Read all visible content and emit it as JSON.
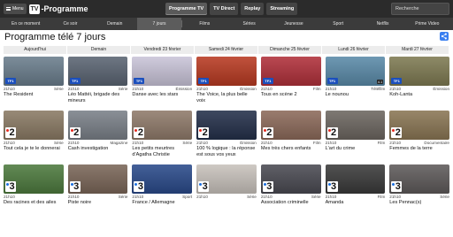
{
  "header": {
    "menu_label": "Menu",
    "logo_box": "TV",
    "logo_text": "-Programme",
    "tabs": [
      {
        "label": "Programme TV"
      },
      {
        "label": "TV Direct"
      },
      {
        "label": "Replay"
      },
      {
        "label": "Streaming"
      }
    ],
    "search_placeholder": "Recherche"
  },
  "subnav": [
    {
      "label": "En ce moment"
    },
    {
      "label": "Ce soir"
    },
    {
      "label": "Demain"
    },
    {
      "label": "7 jours"
    },
    {
      "label": "Films"
    },
    {
      "label": "Séries"
    },
    {
      "label": "Jeunesse"
    },
    {
      "label": "Sport"
    },
    {
      "label": "Netflix"
    },
    {
      "label": "Prime Video"
    }
  ],
  "page_title": "Programme télé 7 jours",
  "days": [
    {
      "label": "Aujourd'hui"
    },
    {
      "label": "Demain"
    },
    {
      "label": "Vendredi 23 février"
    },
    {
      "label": "Samedi 24 février"
    },
    {
      "label": "Dimanche 25 février"
    },
    {
      "label": "Lundi 26 février"
    },
    {
      "label": "Mardi 27 février"
    }
  ],
  "programs": [
    [
      {
        "channel": "TF1",
        "time": "21h10",
        "genre": "Série",
        "title": "The Resident",
        "color": "#6a7d8c"
      },
      {
        "channel": "France 2",
        "time": "21h10",
        "genre": "Série",
        "title": "Tout cela je te le donnerai",
        "color": "#8a7a64"
      },
      {
        "channel": "France 3",
        "time": "21h10",
        "genre": "",
        "title": "Des racines et des ailes",
        "color": "#4d7a3e"
      }
    ],
    [
      {
        "channel": "TF1",
        "time": "21h10",
        "genre": "Série",
        "title": "Léo Mattéi, brigade des mineurs",
        "color": "#5a6472"
      },
      {
        "channel": "France 2",
        "time": "21h10",
        "genre": "Magazine",
        "title": "Cash investigation",
        "color": "#7a8088"
      },
      {
        "channel": "France 3",
        "time": "21h10",
        "genre": "Série",
        "title": "Piste noire",
        "color": "#7a6658"
      }
    ],
    [
      {
        "channel": "TF1",
        "time": "21h10",
        "genre": "Émission",
        "title": "Danse avec les stars",
        "color": "#c9c4d8"
      },
      {
        "channel": "France 2",
        "time": "21h10",
        "genre": "Série",
        "title": "Les petits meurtres d'Agatha Christie",
        "color": "#8f7a6a"
      },
      {
        "channel": "France 3",
        "time": "21h10",
        "genre": "Sport",
        "title": "France / Allemagne",
        "color": "#2a4a8a"
      }
    ],
    [
      {
        "channel": "TF1",
        "time": "21h10",
        "genre": "Émission",
        "title": "The Voice, la plus belle voix",
        "color": "#b83a22"
      },
      {
        "channel": "France 2",
        "time": "21h10",
        "genre": "Émission",
        "title": "100 % logique : la réponse est sous vos yeux",
        "color": "#24304a"
      },
      {
        "channel": "France 3",
        "time": "21h10",
        "genre": "Série",
        "title": "",
        "color": "#c8c2bc"
      }
    ],
    [
      {
        "channel": "TF1",
        "time": "21h10",
        "genre": "Film",
        "title": "Tous en scène 2",
        "color": "#b0303a"
      },
      {
        "channel": "France 2",
        "time": "21h10",
        "genre": "Film",
        "title": "Mes très chers enfants",
        "color": "#8c6a5a"
      },
      {
        "channel": "France 3",
        "time": "21h10",
        "genre": "Série",
        "title": "Association criminelle",
        "color": "#4a4a52"
      }
    ],
    [
      {
        "channel": "TF1",
        "time": "21h10",
        "genre": "Téléfilm",
        "title": "Le nounou",
        "color": "#5a8aa8",
        "rating": "4.1"
      },
      {
        "channel": "France 2",
        "time": "21h10",
        "genre": "Film",
        "title": "L'art du crime",
        "color": "#6c6660"
      },
      {
        "channel": "France 3",
        "time": "21h10",
        "genre": "Film",
        "title": "Amanda",
        "color": "#3a3a3a"
      }
    ],
    [
      {
        "channel": "TF1",
        "time": "21h10",
        "genre": "Émission",
        "title": "Koh-Lanta",
        "color": "#7e7a52"
      },
      {
        "channel": "France 2",
        "time": "21h10",
        "genre": "Documentaire",
        "title": "Femmes de la terre",
        "color": "#8a7654"
      },
      {
        "channel": "France 3",
        "time": "21h10",
        "genre": "Série",
        "title": "Les Pennac(s)",
        "color": "#5e5a5a"
      }
    ]
  ],
  "share_icon": "share-icon"
}
